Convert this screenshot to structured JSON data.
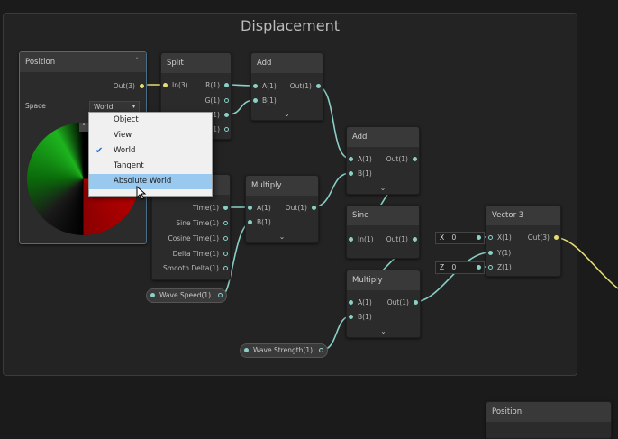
{
  "group": {
    "title": "Displacement"
  },
  "position_node": {
    "title": "Position",
    "out_label": "Out(3)",
    "space_label": "Space",
    "space_value": "World",
    "collapse_glyph": "˄"
  },
  "space_menu": {
    "items": [
      {
        "label": "Object",
        "checked": false,
        "selected": false
      },
      {
        "label": "View",
        "checked": false,
        "selected": false
      },
      {
        "label": "World",
        "checked": true,
        "selected": false
      },
      {
        "label": "Tangent",
        "checked": false,
        "selected": false
      },
      {
        "label": "Absolute World",
        "checked": false,
        "selected": true
      }
    ]
  },
  "split_node": {
    "title": "Split",
    "in": "In(3)",
    "outs": [
      "R(1)",
      "G(1)",
      "B(1)",
      "A(1)"
    ]
  },
  "add_node_1": {
    "title": "Add",
    "ins": [
      "A(1)",
      "B(1)"
    ],
    "out": "Out(1)"
  },
  "add_node_2": {
    "title": "Add",
    "ins": [
      "A(1)",
      "B(1)"
    ],
    "out": "Out(1)"
  },
  "time_node": {
    "outs": [
      "Time(1)",
      "Sine Time(1)",
      "Cosine Time(1)",
      "Delta Time(1)",
      "Smooth Delta(1)"
    ]
  },
  "multiply_node_1": {
    "title": "Multiply",
    "ins": [
      "A(1)",
      "B(1)"
    ],
    "out": "Out(1)"
  },
  "sine_node": {
    "title": "Sine",
    "in": "In(1)",
    "out": "Out(1)"
  },
  "multiply_node_2": {
    "title": "Multiply",
    "ins": [
      "A(1)",
      "B(1)"
    ],
    "out": "Out(1)"
  },
  "vector3_node": {
    "title": "Vector 3",
    "ins": [
      "X(1)",
      "Y(1)",
      "Z(1)"
    ],
    "out": "Out(3)",
    "x_label": "X",
    "x_value": "0",
    "z_label": "Z",
    "z_value": "0"
  },
  "properties": {
    "wave_speed": "Wave Speed(1)",
    "wave_strength": "Wave Strength(1)"
  },
  "position_node_2": {
    "title": "Position"
  },
  "chevron": "⌄",
  "colors": {
    "wire": "#8ad0c6",
    "wire_vec3": "#e6db74",
    "node_bg": "#2b2b2b",
    "header_bg": "#393939"
  }
}
